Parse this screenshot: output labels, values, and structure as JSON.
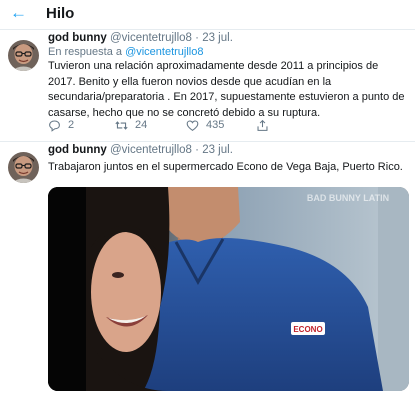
{
  "header": {
    "back_icon": "arrow-left-icon",
    "title": "Hilo",
    "accent": "#1da1f2"
  },
  "tweets": [
    {
      "author": "god bunny",
      "handle": "@vicentetrujllo8",
      "date": "· 23 jul.",
      "reply_prefix": "En respuesta a",
      "reply_to": "@vicentetrujllo8",
      "text": "Tuvieron una relación aproximadamente desde 2011 a principios de 2017. Benito y ella fueron novios desde que acudían en la secundaria/preparatoria . En 2017, supuestamente estuvieron a punto de casarse, hecho que no se concretó debido a su ruptura.",
      "replies": "2",
      "retweets": "24",
      "likes": "435"
    },
    {
      "author": "god bunny",
      "handle": "@vicentetrujllo8",
      "date": "· 23 jul.",
      "text": "Trabajaron juntos en el supermercado Econo de Vega Baja, Puerto Rico.",
      "media_watermark": "BAD BUNNY LATIN",
      "shirt_logo": "ECONO"
    }
  ],
  "icons": {
    "reply": "reply-icon",
    "retweet": "retweet-icon",
    "like": "heart-icon",
    "share": "share-icon"
  }
}
